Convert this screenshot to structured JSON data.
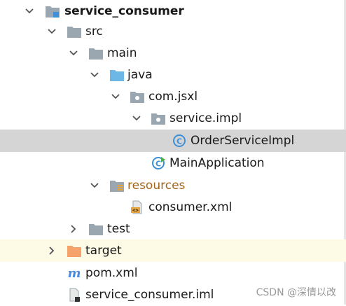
{
  "tree": {
    "root": {
      "label": "service_consumer",
      "icon": "module-folder-icon",
      "expanded": true
    },
    "src": {
      "label": "src",
      "icon": "folder-icon",
      "expanded": true
    },
    "main": {
      "label": "main",
      "icon": "folder-icon",
      "expanded": true
    },
    "java": {
      "label": "java",
      "icon": "source-root-folder-icon",
      "expanded": true
    },
    "package1": {
      "label": "com.jsxl",
      "icon": "package-icon",
      "expanded": true
    },
    "package2": {
      "label": "service.impl",
      "icon": "package-icon",
      "expanded": true
    },
    "class1": {
      "label": "OrderServiceImpl",
      "icon": "java-class-icon",
      "selected": true
    },
    "class2": {
      "label": "MainApplication",
      "icon": "java-main-class-icon"
    },
    "resources": {
      "label": "resources",
      "icon": "resources-folder-icon",
      "expanded": true
    },
    "xmlfile": {
      "label": "consumer.xml",
      "icon": "xml-file-icon"
    },
    "test": {
      "label": "test",
      "icon": "folder-icon",
      "expanded": false
    },
    "target": {
      "label": "target",
      "icon": "excluded-folder-icon",
      "expanded": false
    },
    "pom": {
      "label": "pom.xml",
      "icon": "maven-icon"
    },
    "iml": {
      "label": "service_consumer.iml",
      "icon": "iml-file-icon"
    }
  },
  "watermark": "CSDN @深情以改",
  "colors": {
    "selection": "#d5d5d5",
    "excluded_row": "#fdfbe6",
    "folder": "#9aa7b0",
    "source_folder": "#6cb7e5",
    "excluded_folder": "#f5a26b",
    "class_circle": "#3d8fd8",
    "maven": "#4a8cdd"
  }
}
